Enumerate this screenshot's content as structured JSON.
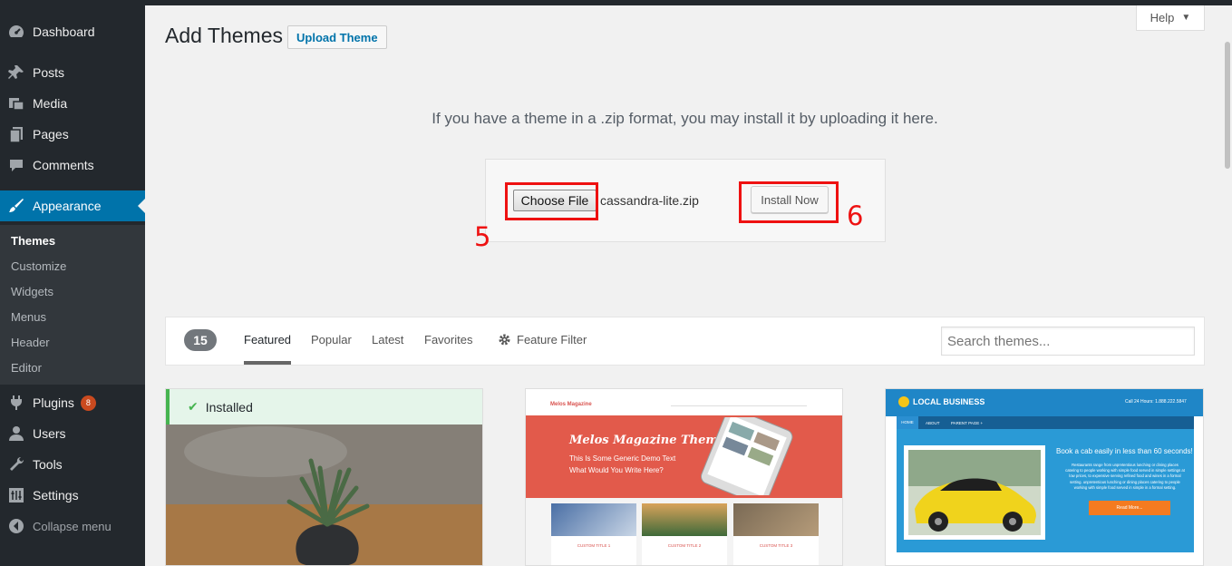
{
  "sidebar": {
    "items": [
      {
        "label": "Dashboard",
        "icon": "dashboard-icon"
      },
      {
        "label": "Posts",
        "icon": "pin-icon"
      },
      {
        "label": "Media",
        "icon": "media-icon"
      },
      {
        "label": "Pages",
        "icon": "pages-icon"
      },
      {
        "label": "Comments",
        "icon": "comment-icon"
      },
      {
        "label": "Appearance",
        "icon": "brush-icon"
      },
      {
        "label": "Plugins",
        "icon": "plugin-icon",
        "badge": "8"
      },
      {
        "label": "Users",
        "icon": "user-icon"
      },
      {
        "label": "Tools",
        "icon": "wrench-icon"
      },
      {
        "label": "Settings",
        "icon": "settings-icon"
      },
      {
        "label": "Collapse menu",
        "icon": "collapse-icon"
      }
    ],
    "submenu": [
      "Themes",
      "Customize",
      "Widgets",
      "Menus",
      "Header",
      "Editor"
    ]
  },
  "header": {
    "title": "Add Themes",
    "upload_label": "Upload Theme",
    "help_label": "Help"
  },
  "upload": {
    "instructions": "If you have a theme in a .zip format, you may install it by uploading it here.",
    "choose_label": "Choose File",
    "file_name": "cassandra-lite.zip",
    "install_label": "Install Now",
    "annotation_5": "5",
    "annotation_6": "6"
  },
  "filter": {
    "count": "15",
    "tabs": [
      "Featured",
      "Popular",
      "Latest",
      "Favorites",
      "Feature Filter"
    ],
    "search_placeholder": "Search themes..."
  },
  "themes": [
    {
      "status": "Installed"
    },
    {
      "nav_brand": "Melos Magazine",
      "hero_title": "Melos Magazine Theme",
      "hero_sub_1": "This Is Some Generic Demo Text",
      "hero_sub_2": "What Would You Write Here?",
      "post_titles": [
        "CUSTOM TITLE 1",
        "CUSTOM TITLE 2",
        "CUSTOM TITLE 3"
      ]
    },
    {
      "brand": "LOCAL BUSINESS",
      "phone": "Call 24 Hours: 1.888.222.5847",
      "nav": [
        "HOME",
        "ABOUT",
        "PARENT PAGE +"
      ],
      "headline": "Book a cab easily in less than 60 seconds!",
      "body": "Restaurants range from unpretentious lunching or dining places catering to people working with simple food served in simple settings at low prices, to expensive serving refined food and wines in a formal setting. unpretentious lunching or dining places catering to people working with simple food served in simple in a formal setting.",
      "cta": "Read More..."
    }
  ],
  "colors": {
    "sidebar_bg": "#23282d",
    "accent": "#0073aa",
    "annotation_red": "#ee1111",
    "installed_green": "#46b450"
  }
}
